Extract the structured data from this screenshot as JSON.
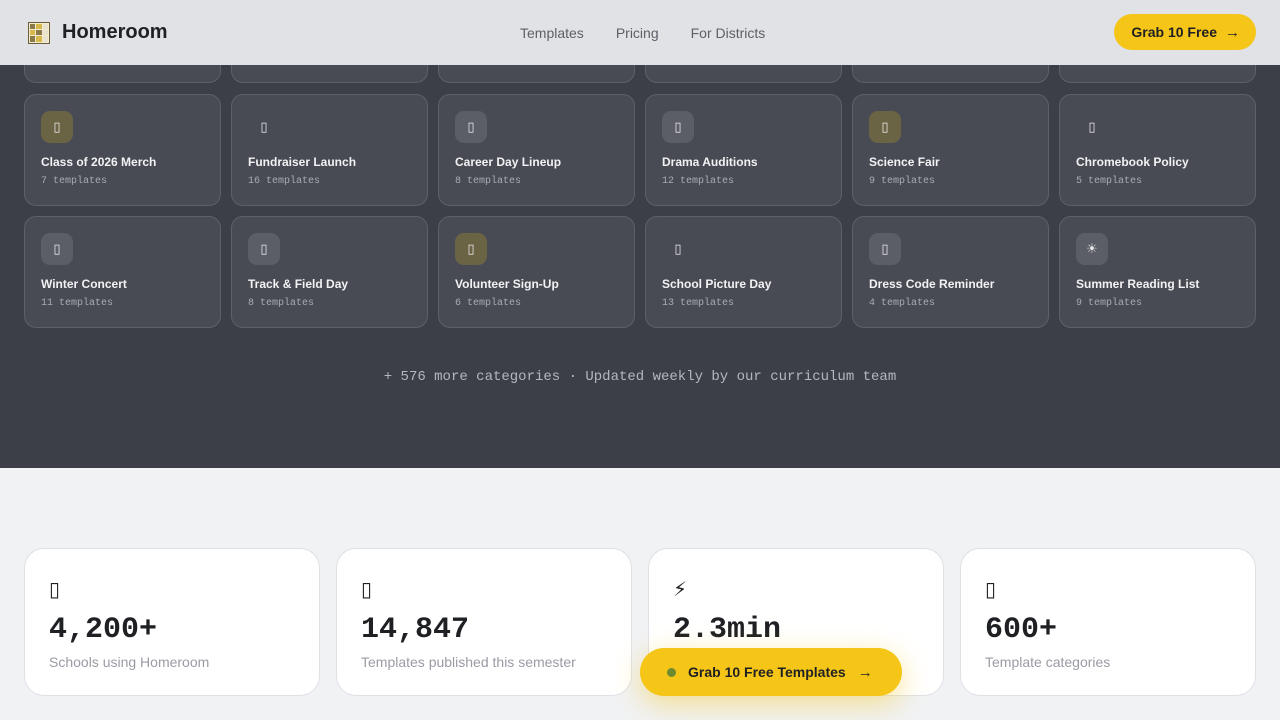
{
  "header": {
    "brand": "Homeroom",
    "nav": [
      "Templates",
      "Pricing",
      "For Districts"
    ],
    "cta": "Grab 10 Free",
    "cta_arrow": "→"
  },
  "categories": [
    {
      "title": "Class of 2026 Merch",
      "count": "7 templates",
      "icon": "▯",
      "icon_style": "gold"
    },
    {
      "title": "Fundraiser Launch",
      "count": "16 templates",
      "icon": "▯",
      "icon_style": "none"
    },
    {
      "title": "Career Day Lineup",
      "count": "8 templates",
      "icon": "▯",
      "icon_style": "grey"
    },
    {
      "title": "Drama Auditions",
      "count": "12 templates",
      "icon": "▯",
      "icon_style": "grey"
    },
    {
      "title": "Science Fair",
      "count": "9 templates",
      "icon": "▯",
      "icon_style": "gold"
    },
    {
      "title": "Chromebook Policy",
      "count": "5 templates",
      "icon": "▯",
      "icon_style": "none"
    },
    {
      "title": "Winter Concert",
      "count": "11 templates",
      "icon": "▯",
      "icon_style": "grey"
    },
    {
      "title": "Track & Field Day",
      "count": "8 templates",
      "icon": "▯",
      "icon_style": "grey"
    },
    {
      "title": "Volunteer Sign-Up",
      "count": "6 templates",
      "icon": "▯",
      "icon_style": "gold"
    },
    {
      "title": "School Picture Day",
      "count": "13 templates",
      "icon": "▯",
      "icon_style": "none"
    },
    {
      "title": "Dress Code Reminder",
      "count": "4 templates",
      "icon": "▯",
      "icon_style": "grey"
    },
    {
      "title": "Summer Reading List",
      "count": "9 templates",
      "icon": "☀",
      "icon_style": "grey"
    }
  ],
  "more_text": "+ 576 more categories · Updated weekly by our curriculum team",
  "stats": [
    {
      "icon": "▯",
      "value": "4,200+",
      "label": "Schools using Homeroom"
    },
    {
      "icon": "▯",
      "value": "14,847",
      "label": "Templates published this semester"
    },
    {
      "icon": "⚡",
      "value": "2.3min",
      "label": ""
    },
    {
      "icon": "▯",
      "value": "600+",
      "label": "Template categories"
    }
  ],
  "floating_cta": {
    "label": "Grab 10 Free Templates",
    "arrow": "→"
  },
  "colors": {
    "accent": "#f5c518",
    "dark_bg": "#3d3f48",
    "card_bg": "#494b54"
  }
}
